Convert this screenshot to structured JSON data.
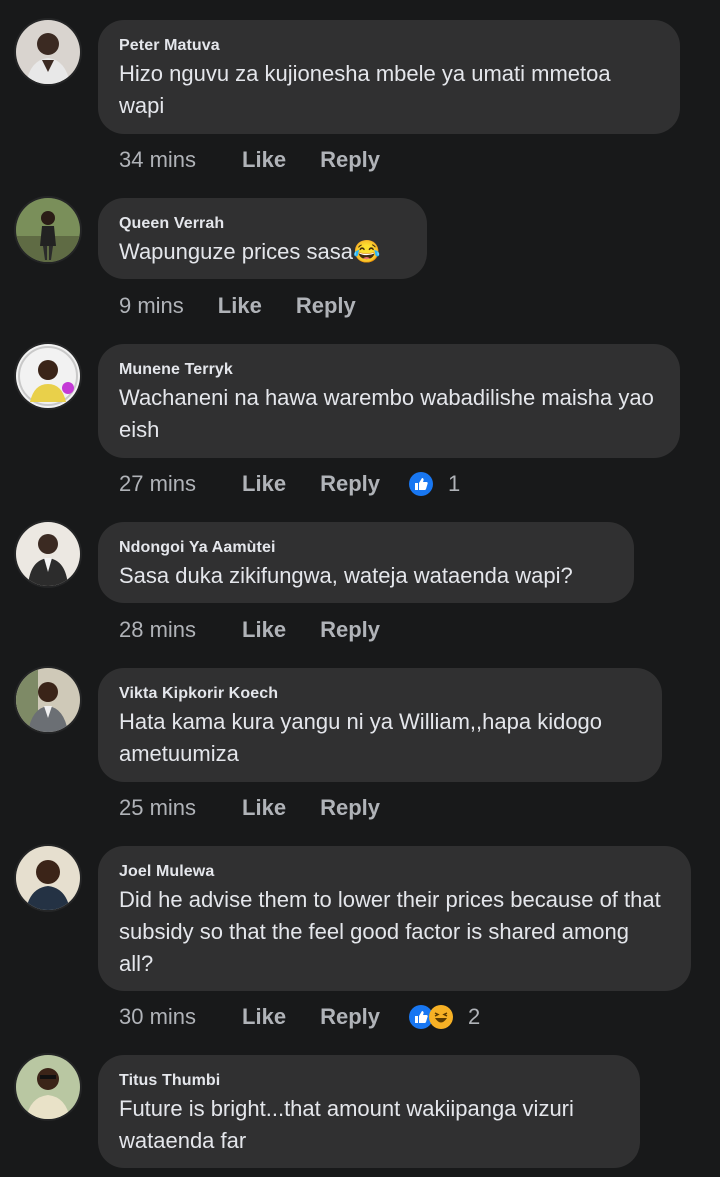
{
  "colors": {
    "background": "#18191a",
    "bubble": "#303031",
    "text": "#e4e6eb",
    "meta": "#b0b3b8",
    "like_blue": "#1877f2",
    "haha_yellow": "#f7b125"
  },
  "comments": [
    {
      "author": "Peter Matuva",
      "text": "Hizo nguvu za kujionesha mbele ya umati mmetoa wapi",
      "time": "34 mins",
      "like": "Like",
      "reply": "Reply"
    },
    {
      "author": "Queen Verrah",
      "text": "Wapunguze prices sasa😂",
      "time": "9 mins",
      "like": "Like",
      "reply": "Reply"
    },
    {
      "author": "Munene Terryk",
      "text": "Wachaneni na hawa warembo wabadilishe maisha yao eish",
      "time": "27 mins",
      "like": "Like",
      "reply": "Reply",
      "reactions": {
        "icons": [
          "like-icon"
        ],
        "count": "1"
      }
    },
    {
      "author": "Ndongoi Ya Aamùtei",
      "text": "Sasa duka zikifungwa, wateja wataenda wapi?",
      "time": "28 mins",
      "like": "Like",
      "reply": "Reply"
    },
    {
      "author": "Vikta Kipkorir Koech",
      "text": "Hata kama kura yangu ni ya William,,hapa kidogo ametuumiza",
      "time": "25 mins",
      "like": "Like",
      "reply": "Reply"
    },
    {
      "author": "Joel Mulewa",
      "text": "Did he advise them to lower their prices because of that subsidy so that the feel good factor is shared among all?",
      "time": "30 mins",
      "like": "Like",
      "reply": "Reply",
      "reactions": {
        "icons": [
          "like-icon",
          "haha-icon"
        ],
        "count": "2"
      }
    },
    {
      "author": "Titus Thumbi",
      "text": "Future is bright...that amount wakiipanga vizuri wataenda far"
    }
  ]
}
